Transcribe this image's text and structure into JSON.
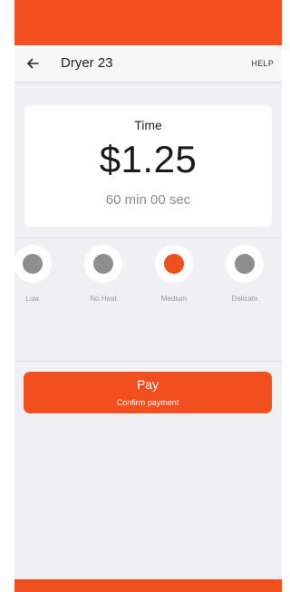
{
  "colors": {
    "accent": "#f24e1e",
    "background": "#efeff4",
    "inactive_dot": "#8e8e8e"
  },
  "header": {
    "back_icon": "arrow-left-icon",
    "title": "Dryer 23",
    "help_label": "HELP"
  },
  "summary": {
    "label": "Time",
    "price": "$1.25",
    "duration": "60 min 00 sec"
  },
  "heat_options": [
    {
      "label": "Low",
      "selected": false
    },
    {
      "label": "No Heat",
      "selected": false
    },
    {
      "label": "Medium",
      "selected": true
    },
    {
      "label": "Delicate",
      "selected": false
    }
  ],
  "pay": {
    "label": "Pay",
    "sublabel": "Confirm payment"
  }
}
